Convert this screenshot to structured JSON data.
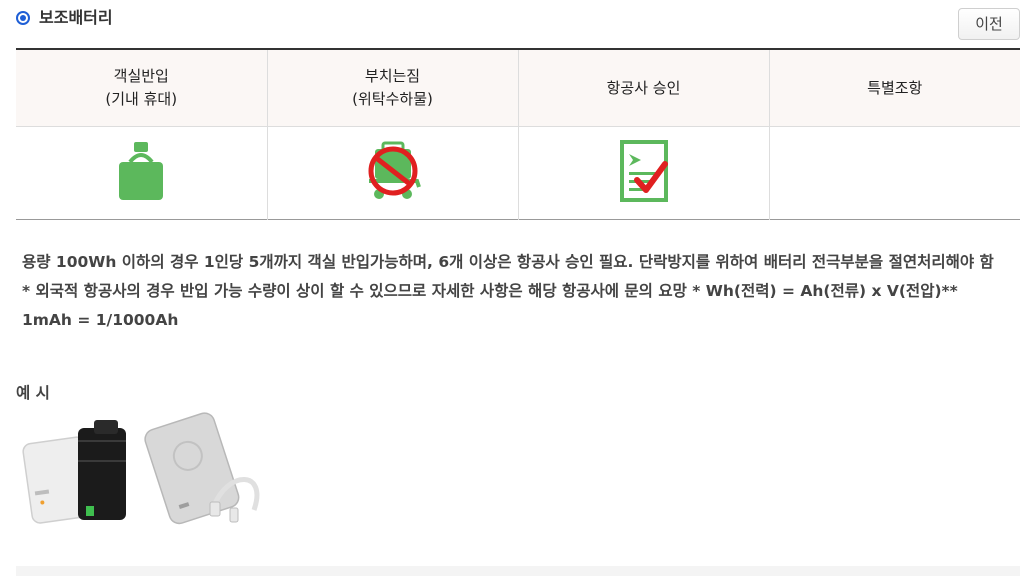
{
  "header": {
    "title": "보조배터리",
    "prev_button": "이전"
  },
  "table": {
    "columns": [
      {
        "line1": "객실반입",
        "line2": "(기내 휴대)"
      },
      {
        "line1": "부치는짐",
        "line2": "(위탁수하물)"
      },
      {
        "line1": "항공사 승인",
        "line2": ""
      },
      {
        "line1": "특별조항",
        "line2": ""
      }
    ],
    "icons": [
      "carry-on-bag-allowed-icon",
      "checked-baggage-prohibited-icon",
      "airline-approval-required-icon",
      ""
    ],
    "colors": {
      "allowed": "#5cb85c",
      "prohibited": "#e02020",
      "check": "#e02020"
    }
  },
  "description": "용량 100Wh 이하의 경우 1인당 5개까지 객실 반입가능하며, 6개 이상은 항공사 승인 필요. 단락방지를 위하여 배터리 전극부분을 절연처리해야 함 * 외국적 항공사의 경우 반입 가능 수량이 상이 할 수 있으므로 자세한 사항은 해당 항공사에 문의 요망 * Wh(전력) = Ah(전류) x V(전압)** 1mAh = 1/1000Ah",
  "example": {
    "label": "예 시",
    "image_description": "power-bank-examples"
  }
}
